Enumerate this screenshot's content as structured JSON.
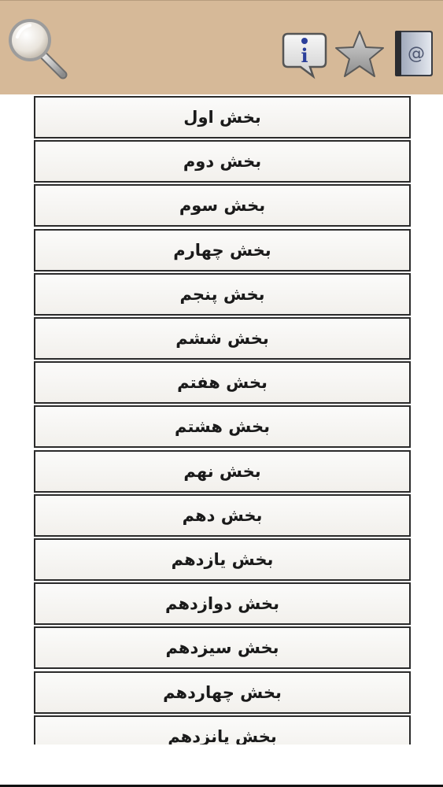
{
  "header": {
    "icons": [
      "search-icon",
      "info-icon",
      "star-icon",
      "contacts-icon"
    ]
  },
  "sections": [
    {
      "label": "بخش اول"
    },
    {
      "label": "بخش دوم"
    },
    {
      "label": "بخش سوم"
    },
    {
      "label": "بخش چهارم"
    },
    {
      "label": "بخش پنجم"
    },
    {
      "label": "بخش ششم"
    },
    {
      "label": "بخش هفتم"
    },
    {
      "label": "بخش هشتم"
    },
    {
      "label": "بخش نهم"
    },
    {
      "label": "بخش دهم"
    },
    {
      "label": "بخش یازدهم"
    },
    {
      "label": "بخش دوازدهم"
    },
    {
      "label": "بخش سیزدهم"
    },
    {
      "label": "بخش چهاردهم"
    },
    {
      "label": "بخش پانزدهم"
    }
  ],
  "colors": {
    "header_bg": "#d6b998",
    "item_border": "#2a2a2a"
  }
}
